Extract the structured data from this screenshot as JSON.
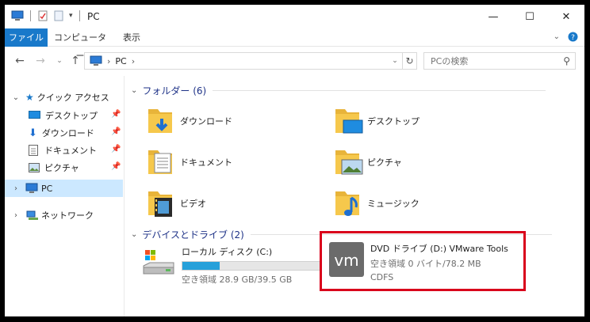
{
  "window": {
    "title": "PC"
  },
  "ribbon": {
    "tabs": [
      "ファイル",
      "コンピューター",
      "表示"
    ]
  },
  "address": {
    "root": "PC"
  },
  "search": {
    "placeholder": "PCの検索"
  },
  "nav": {
    "quick_access": "クイック アクセス",
    "items": [
      "デスクトップ",
      "ダウンロード",
      "ドキュメント",
      "ピクチャ"
    ],
    "pc": "PC",
    "network": "ネットワーク"
  },
  "folders": {
    "header": "フォルダー (6)",
    "items": [
      "ダウンロード",
      "デスクトップ",
      "ドキュメント",
      "ピクチャ",
      "ビデオ",
      "ミュージック"
    ]
  },
  "devices": {
    "header": "デバイスとドライブ (2)",
    "local": {
      "name": "ローカル ディスク (C:)",
      "free": "空き領域 28.9 GB/39.5 GB",
      "used_fraction": 0.27
    },
    "dvd": {
      "name": "DVD ドライブ (D:) VMware Tools",
      "free": "空き領域 0 バイト/78.2 MB",
      "fs": "CDFS",
      "logo": "vm"
    }
  },
  "colors": {
    "accent": "#1979ca",
    "highlight": "#d9001b",
    "folder": "#f6c84c",
    "selected": "#cce8ff"
  }
}
